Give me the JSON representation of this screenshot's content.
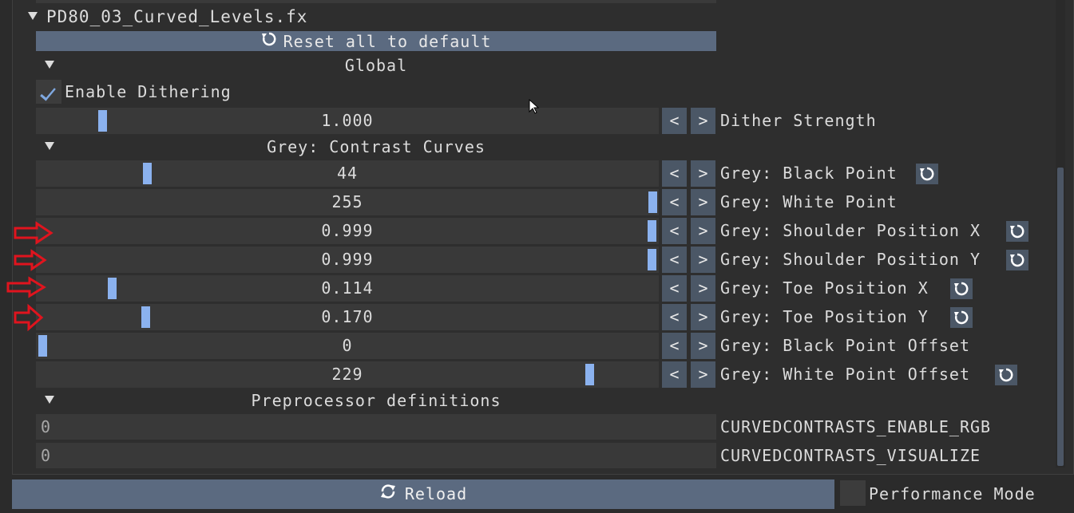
{
  "effect": {
    "name": "PD80_03_Curved_Levels.fx",
    "reset_all_label": "Reset all to default"
  },
  "sections": {
    "global": "Global",
    "grey": "Grey: Contrast Curves",
    "preprocessor": "Preprocessor definitions"
  },
  "checkbox": {
    "label": "Enable Dithering",
    "checked": true
  },
  "rows": [
    {
      "value": "1.000",
      "label": "Dither Strength",
      "fill": 0.1,
      "reset": false
    },
    {
      "value": "44",
      "label": "Grey: Black Point",
      "fill": 0.17,
      "reset": true
    },
    {
      "value": "255",
      "label": "Grey: White Point",
      "fill": 1.0,
      "reset": false
    },
    {
      "value": "0.999",
      "label": "Grey: Shoulder Position X",
      "fill": 0.999,
      "reset": true
    },
    {
      "value": "0.999",
      "label": "Grey: Shoulder Position Y",
      "fill": 0.999,
      "reset": true
    },
    {
      "value": "0.114",
      "label": "Grey: Toe Position X",
      "fill": 0.114,
      "reset": true
    },
    {
      "value": "0.170",
      "label": "Grey: Toe Position Y",
      "fill": 0.17,
      "reset": true
    },
    {
      "value": "0",
      "label": "Grey: Black Point Offset",
      "fill": 0.0,
      "reset": false
    },
    {
      "value": "229",
      "label": "Grey: White Point Offset",
      "fill": 0.9,
      "reset": true
    }
  ],
  "buttons": {
    "decrement": "<",
    "increment": ">"
  },
  "defines": [
    {
      "value": "0",
      "label": "CURVEDCONTRASTS_ENABLE_RGB"
    },
    {
      "value": "0",
      "label": "CURVEDCONTRASTS_VISUALIZE"
    }
  ],
  "footer": {
    "reload_label": "Reload",
    "performance_label": "Performance Mode",
    "performance_checked": false
  },
  "colors": {
    "accent": "#8bb2ef",
    "button": "#4b5766",
    "bar": "#5b6a80",
    "annotation_arrow": "#e0141e"
  }
}
